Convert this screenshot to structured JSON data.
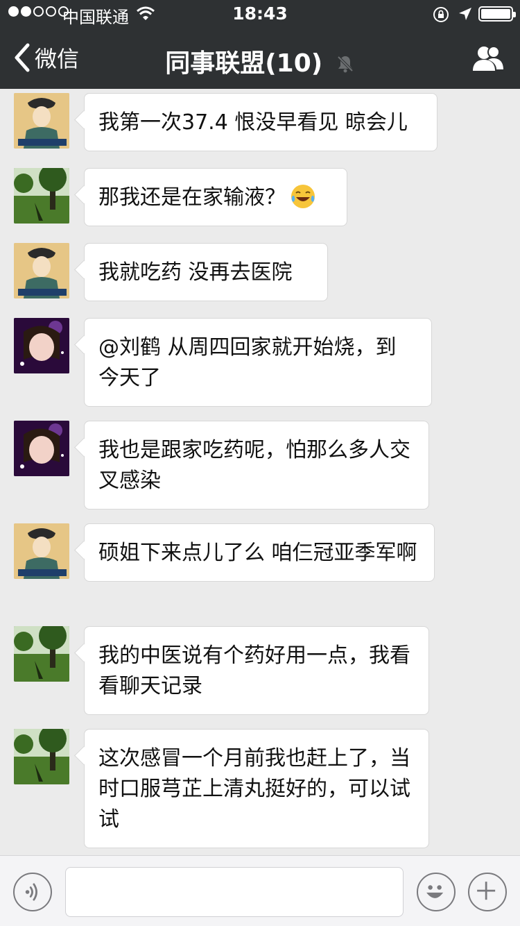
{
  "status_bar": {
    "carrier": "中国联通",
    "time": "18:43",
    "signal_bars_full": 2,
    "signal_bars_total": 5
  },
  "nav": {
    "back_label": "微信",
    "title": "同事联盟(10)",
    "icons": [
      "chevron-left-icon",
      "mute-bell-icon",
      "group-members-icon"
    ]
  },
  "messages": [
    {
      "avatar": "classical-lady",
      "text": "我第一次37.4 恨没早看见 晾会儿"
    },
    {
      "avatar": "park",
      "text": "那我还是在家输液？",
      "emoji": "tears-of-joy"
    },
    {
      "avatar": "classical-lady",
      "text": "我就吃药 没再去医院"
    },
    {
      "avatar": "purple-girl",
      "text": "@刘鹤 从周四回家就开始烧，到今天了"
    },
    {
      "avatar": "purple-girl",
      "text": "我也是跟家吃药呢，怕那么多人交叉感染"
    },
    {
      "avatar": "classical-lady",
      "text": "硕姐下来点儿了么 咱仨冠亚季军啊"
    },
    {
      "avatar": "park",
      "text": "我的中医说有个药好用一点，我看看聊天记录"
    },
    {
      "avatar": "park",
      "text": "这次感冒一个月前我也赶上了，当时口服芎芷上清丸挺好的，可以试试"
    }
  ],
  "input_bar": {
    "text_value": "",
    "icons": [
      "voice-icon",
      "emoji-icon",
      "plus-icon"
    ]
  },
  "colors": {
    "header_bg": "#2e3133",
    "chat_bg": "#ebebeb",
    "bubble_bg": "#ffffff"
  }
}
